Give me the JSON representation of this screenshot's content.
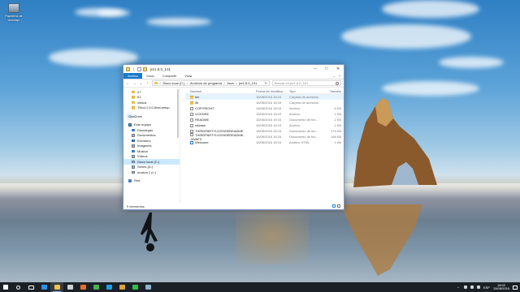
{
  "desktop": {
    "icons": [
      {
        "label": "Papelera de reciclaje"
      }
    ]
  },
  "window": {
    "title": "jre1.8.0_101",
    "ribbon_tabs": [
      "Archivo",
      "Inicio",
      "Compartir",
      "Vista"
    ],
    "address": {
      "crumbs": [
        "Disco local (C:)",
        "Archivos de programa",
        "Java",
        "jre1.8.0_101"
      ],
      "separator": ">"
    },
    "search": {
      "placeholder": "Buscar en jre1.8.0_101"
    },
    "nav": {
      "quick": [
        {
          "label": "07"
        },
        {
          "label": "61"
        },
        {
          "label": "clinica"
        },
        {
          "label": "TNcd-1.0.0-final-setup"
        }
      ],
      "onedrive": "OneDrive",
      "this_pc": "Este equipo",
      "pc_items": [
        {
          "label": "Descargas",
          "icon": "download-icon"
        },
        {
          "label": "Documentos",
          "icon": "documents-icon"
        },
        {
          "label": "Escritorio",
          "icon": "desktop-icon"
        },
        {
          "label": "Imágenes",
          "icon": "pictures-icon"
        },
        {
          "label": "Música",
          "icon": "music-icon"
        },
        {
          "label": "Vídeos",
          "icon": "videos-icon"
        }
      ],
      "drives": [
        {
          "label": "Disco local (C:)"
        },
        {
          "label": "Series (D:)"
        },
        {
          "label": "musica 2 (L:)"
        }
      ],
      "network": "Red"
    },
    "columns": {
      "name": "Nombre",
      "date": "Fecha de modifica...",
      "type": "Tipo",
      "size": "Tamaño"
    },
    "files": [
      {
        "name": "bin",
        "date": "15/08/2016 18:15",
        "type": "Carpeta de archivos",
        "size": "",
        "icon": "folder"
      },
      {
        "name": "lib",
        "date": "15/08/2016 18:15",
        "type": "Carpeta de archivos",
        "size": "",
        "icon": "folder"
      },
      {
        "name": "COPYRIGHT",
        "date": "15/08/2016 18:15",
        "type": "Archivo",
        "size": "4 KB",
        "icon": "doc"
      },
      {
        "name": "LICENSE",
        "date": "15/08/2016 18:15",
        "type": "Archivo",
        "size": "1 KB",
        "icon": "doc"
      },
      {
        "name": "README",
        "date": "15/08/2016 18:15",
        "type": "Documento de tex...",
        "size": "1 KB",
        "icon": "doc"
      },
      {
        "name": "release",
        "date": "15/08/2016 18:15",
        "type": "Archivo",
        "size": "1 KB",
        "icon": "doc"
      },
      {
        "name": "THIRDPARTYLICENSEREADME",
        "date": "15/08/2016 18:15",
        "type": "Documento de tex...",
        "size": "173 KB",
        "icon": "doc"
      },
      {
        "name": "THIRDPARTYLICENSEREADME-JAVAFX",
        "date": "15/08/2016 18:15",
        "type": "Documento de tex...",
        "size": "108 KB",
        "icon": "doc"
      },
      {
        "name": "Welcome",
        "date": "15/08/2016 18:15",
        "type": "Archivo HTML",
        "size": "1 KB",
        "icon": "html"
      }
    ],
    "status": "9 elementos"
  },
  "taskbar": {
    "apps": [
      {
        "icon": "search-icon",
        "color": "#ffffff"
      },
      {
        "icon": "task-view-icon",
        "color": "#ffffff"
      },
      {
        "icon": "edge-icon",
        "color": "#2d8fe0"
      },
      {
        "icon": "file-explorer-icon",
        "color": "#f0c24b"
      },
      {
        "icon": "store-icon",
        "color": "#d0d0d0"
      },
      {
        "icon": "firefox-icon",
        "color": "#e6702a"
      },
      {
        "icon": "chrome-icon",
        "color": "#4caf50"
      },
      {
        "icon": "skype-icon",
        "color": "#1aa0e6"
      },
      {
        "icon": "folder-icon",
        "color": "#d9a441"
      },
      {
        "icon": "whatsapp-icon",
        "color": "#2fbf4a"
      },
      {
        "icon": "steam-icon",
        "color": "#8db3cf"
      }
    ],
    "language": "ESP",
    "time": "18:02",
    "date": "15/08/2016"
  }
}
